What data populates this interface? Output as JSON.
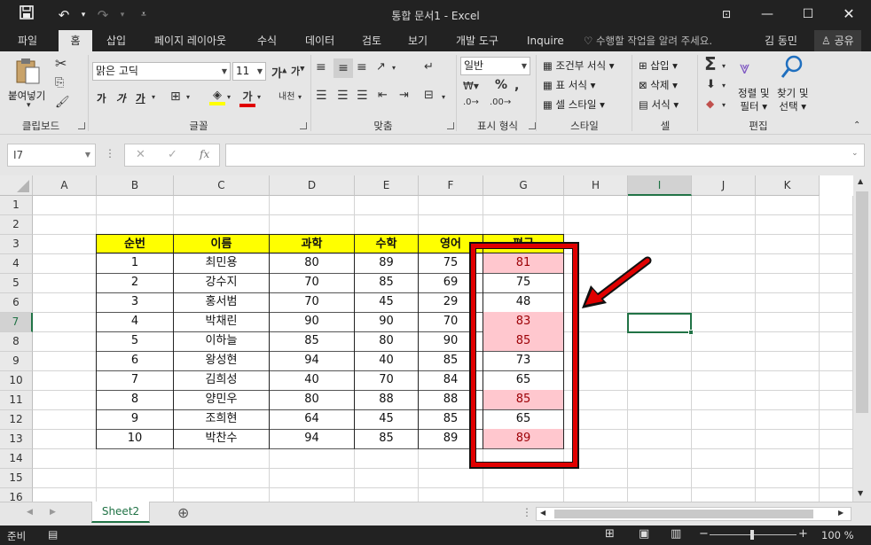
{
  "titlebar": {
    "title": "통합 문서1 - Excel",
    "save_icon": "save-icon",
    "undo_icon": "undo-icon",
    "redo_icon": "redo-icon",
    "customize_icon": "customize-icon"
  },
  "tabs": [
    "파일",
    "홈",
    "삽입",
    "페이지 레이아웃",
    "수식",
    "데이터",
    "검토",
    "보기",
    "개발 도구",
    "Inquire"
  ],
  "active_tab": "홈",
  "tell_me": "수행할 작업을 알려 주세요.",
  "user": "김 동민",
  "share": "공유",
  "ribbon": {
    "clipboard": {
      "label": "클립보드",
      "paste": "붙여넣기"
    },
    "font": {
      "label": "글꼴",
      "font_name": "맑은 고딕",
      "font_size": "11",
      "bold": "가",
      "italic": "가",
      "underline": "가"
    },
    "alignment": {
      "label": "맞춤"
    },
    "number": {
      "label": "표시 형식",
      "format": "일반"
    },
    "styles": {
      "label": "스타일",
      "conditional": "조건부 서식",
      "table": "표 서식",
      "cell_styles": "셀 스타일"
    },
    "cells": {
      "label": "셀",
      "insert": "삽입",
      "delete": "삭제",
      "format": "서식"
    },
    "editing": {
      "label": "편집",
      "sort1": "정렬 및",
      "sort2": "필터",
      "find1": "찾기 및",
      "find2": "선택"
    }
  },
  "formula_bar": {
    "name_box": "I7",
    "fx": "fx",
    "value": ""
  },
  "columns": [
    "A",
    "B",
    "C",
    "D",
    "E",
    "F",
    "G",
    "H",
    "I",
    "J",
    "K"
  ],
  "rows": [
    "1",
    "2",
    "3",
    "4",
    "5",
    "6",
    "7",
    "8",
    "9",
    "10",
    "11",
    "12",
    "13",
    "14",
    "15",
    "16"
  ],
  "table": {
    "headers": [
      "순번",
      "이름",
      "과학",
      "수학",
      "영어",
      "평균"
    ],
    "rows": [
      [
        "1",
        "최민용",
        "80",
        "89",
        "75",
        "81"
      ],
      [
        "2",
        "강수지",
        "70",
        "85",
        "69",
        "75"
      ],
      [
        "3",
        "홍서범",
        "70",
        "45",
        "29",
        "48"
      ],
      [
        "4",
        "박채린",
        "90",
        "90",
        "70",
        "83"
      ],
      [
        "5",
        "이하늘",
        "85",
        "80",
        "90",
        "85"
      ],
      [
        "6",
        "왕성현",
        "94",
        "40",
        "85",
        "73"
      ],
      [
        "7",
        "김희성",
        "40",
        "70",
        "84",
        "65"
      ],
      [
        "8",
        "양민우",
        "80",
        "88",
        "88",
        "85"
      ],
      [
        "9",
        "조희현",
        "64",
        "45",
        "85",
        "65"
      ],
      [
        "10",
        "박찬수",
        "94",
        "85",
        "89",
        "89"
      ]
    ],
    "highlighted_rows": [
      0,
      3,
      4,
      7,
      9
    ]
  },
  "sheet": {
    "tab": "Sheet2",
    "add_icon": "add-sheet-icon"
  },
  "status": {
    "ready": "준비",
    "zoom": "100 %"
  },
  "colors": {
    "accent": "#217346",
    "header_fill": "#ffff00",
    "highlight_fill": "#ffc7ce",
    "highlight_text": "#9c0006",
    "annotation": "#e00000"
  }
}
